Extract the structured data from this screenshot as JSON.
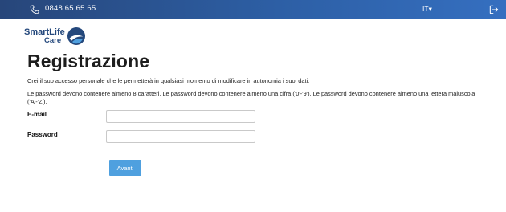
{
  "topbar": {
    "phone_icon": "phone-icon",
    "phone_number": "0848 65 65 65",
    "language": "IT",
    "language_caret": "▾",
    "logout_icon": "logout-icon"
  },
  "logo": {
    "line1": "SmartLife",
    "line2": "Care"
  },
  "page": {
    "title": "Registrazione",
    "intro": "Crei il suo accesso personale che le permetterà in qualsiasi momento di modificare in autonomia i suoi dati.",
    "password_rules": "Le password devono contenere almeno 8 caratteri. Le password devono contenere almeno una cifra ('0'-'9'). Le password devono contenere almeno una lettera maiuscola ('A'-'Z')."
  },
  "form": {
    "email_label": "E-mail",
    "email_value": "",
    "password_label": "Password",
    "password_value": "",
    "submit_label": "Avanti"
  },
  "colors": {
    "topbar": "#2d5fa5",
    "brand": "#24487c",
    "button": "#4fa0df"
  }
}
